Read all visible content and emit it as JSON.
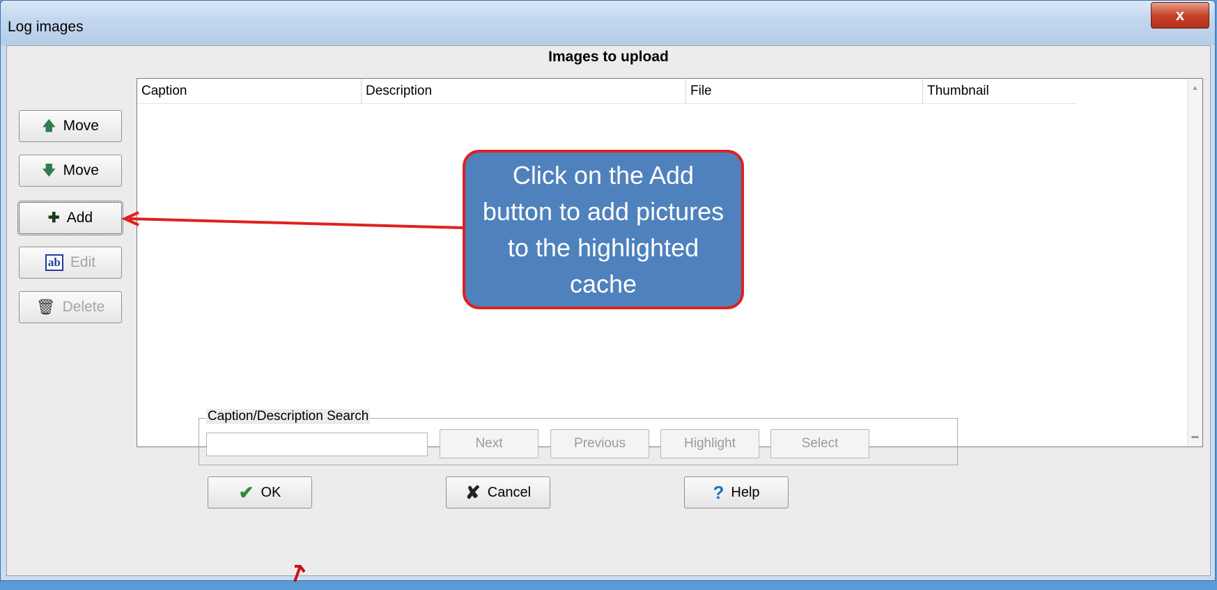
{
  "window": {
    "title": "Log images",
    "close_glyph": "x"
  },
  "list": {
    "heading": "Images to upload",
    "columns": [
      "Caption",
      "Description",
      "File",
      "Thumbnail"
    ]
  },
  "side_buttons": {
    "move_up": {
      "label": "Move",
      "icon": "arrow-up-icon"
    },
    "move_down": {
      "label": "Move",
      "icon": "arrow-down-icon"
    },
    "add": {
      "label": "Add",
      "icon": "plus-icon"
    },
    "edit": {
      "label": "Edit",
      "icon": "ab-edit-icon"
    },
    "delete": {
      "label": "Delete",
      "icon": "trash-icon"
    }
  },
  "search": {
    "label": "Caption/Description Search",
    "value": "",
    "buttons": [
      "Next",
      "Previous",
      "Highlight",
      "Select"
    ]
  },
  "bottom_buttons": {
    "ok": {
      "label": "OK",
      "icon": "check-icon"
    },
    "cancel": {
      "label": "Cancel",
      "icon": "x-icon"
    },
    "help": {
      "label": "Help",
      "icon": "question-icon"
    }
  },
  "callout": {
    "text": "Click on the Add button to add pictures to the highlighted cache"
  },
  "colors": {
    "callout_fill": "#4f81bd",
    "callout_border": "#e02020",
    "arrow": "#e02020"
  }
}
